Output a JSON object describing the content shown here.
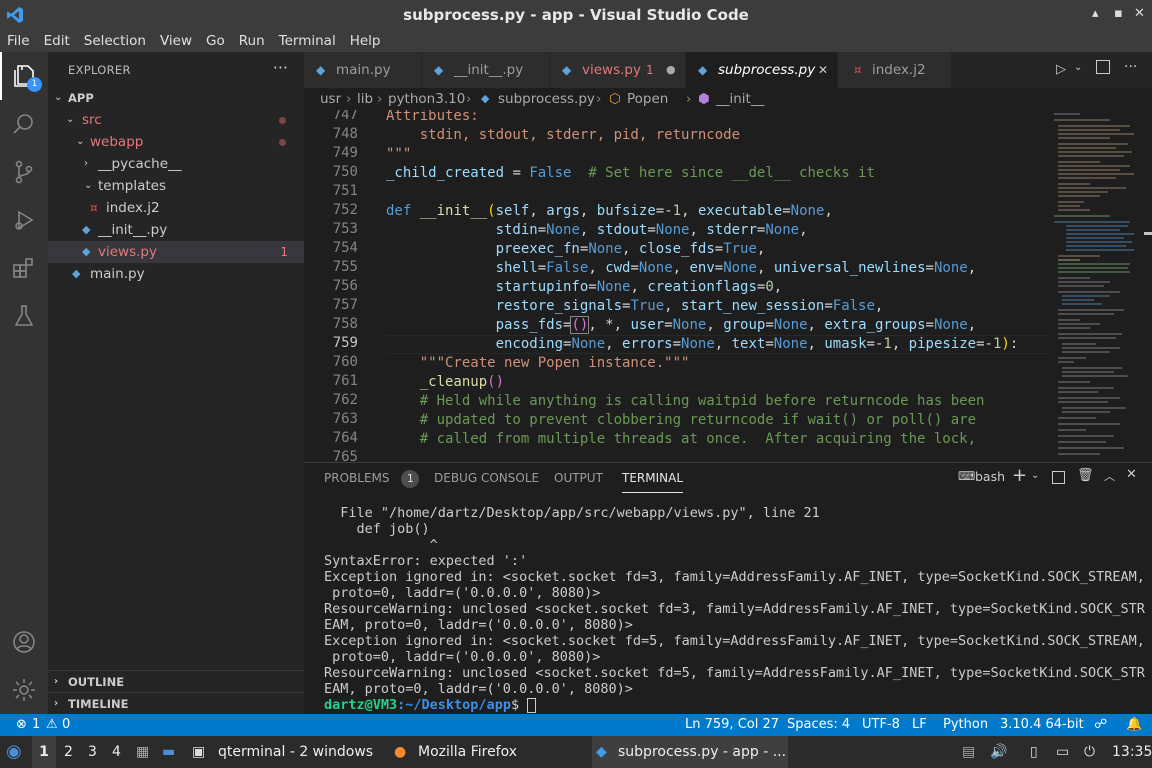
{
  "window": {
    "title": "subprocess.py - app - Visual Studio Code"
  },
  "menu": [
    "File",
    "Edit",
    "Selection",
    "View",
    "Go",
    "Run",
    "Terminal",
    "Help"
  ],
  "activity": {
    "explorer_badge": "1"
  },
  "sidebar": {
    "header": "EXPLORER",
    "root": "APP",
    "items": [
      {
        "label": "src"
      },
      {
        "label": "webapp"
      },
      {
        "label": "__pycache__"
      },
      {
        "label": "templates"
      },
      {
        "label": "index.j2"
      },
      {
        "label": "__init__.py"
      },
      {
        "label": "views.py",
        "badge": "1"
      },
      {
        "label": "main.py"
      }
    ],
    "outline": "OUTLINE",
    "timeline": "TIMELINE"
  },
  "tabs": [
    {
      "label": "main.py"
    },
    {
      "label": "__init__.py"
    },
    {
      "label": "views.py",
      "badge": "1"
    },
    {
      "label": "subprocess.py"
    },
    {
      "label": "index.j2"
    }
  ],
  "breadcrumb": [
    "usr",
    "lib",
    "python3.10",
    "subprocess.py",
    "Popen",
    "__init__"
  ],
  "editor": {
    "line_numbers": [
      "747",
      "748",
      "749",
      "750",
      "751",
      "752",
      "753",
      "754",
      "755",
      "756",
      "757",
      "758",
      "759",
      "760",
      "761",
      "762",
      "763",
      "764",
      "765"
    ]
  },
  "panel": {
    "tabs": {
      "problems": "PROBLEMS",
      "problems_count": "1",
      "debug": "DEBUG CONSOLE",
      "output": "OUTPUT",
      "terminal": "TERMINAL"
    },
    "shell": "bash",
    "terminal_lines": [
      "  File \"/home/dartz/Desktop/app/src/webapp/views.py\", line 21",
      "    def job()",
      "             ^",
      "SyntaxError: expected ':'",
      "Exception ignored in: <socket.socket fd=3, family=AddressFamily.AF_INET, type=SocketKind.SOCK_STREAM,",
      " proto=0, laddr=('0.0.0.0', 8080)>",
      "ResourceWarning: unclosed <socket.socket fd=3, family=AddressFamily.AF_INET, type=SocketKind.SOCK_STR",
      "EAM, proto=0, laddr=('0.0.0.0', 8080)>",
      "Exception ignored in: <socket.socket fd=5, family=AddressFamily.AF_INET, type=SocketKind.SOCK_STREAM,",
      " proto=0, laddr=('0.0.0.0', 8080)>",
      "ResourceWarning: unclosed <socket.socket fd=5, family=AddressFamily.AF_INET, type=SocketKind.SOCK_STR",
      "EAM, proto=0, laddr=('0.0.0.0', 8080)>"
    ],
    "prompt_user": "dartz@VM3",
    "prompt_path": ":~/Desktop/app",
    "prompt_end": "$ "
  },
  "status": {
    "errors": "1",
    "warnings": "0",
    "position": "Ln 759, Col 27",
    "spaces": "Spaces: 4",
    "encoding": "UTF-8",
    "eol": "LF",
    "language": "Python",
    "interpreter": "3.10.4 64-bit"
  },
  "taskbar": {
    "workspaces": [
      "1",
      "2",
      "3",
      "4"
    ],
    "apps": [
      {
        "label": "qterminal - 2 windows"
      },
      {
        "label": "Mozilla Firefox"
      },
      {
        "label": "subprocess.py - app - ..."
      }
    ],
    "clock": "13:35"
  },
  "colors": {
    "accent": "#007acc",
    "error": "#f48771",
    "activity_badge": "#3794ff"
  }
}
